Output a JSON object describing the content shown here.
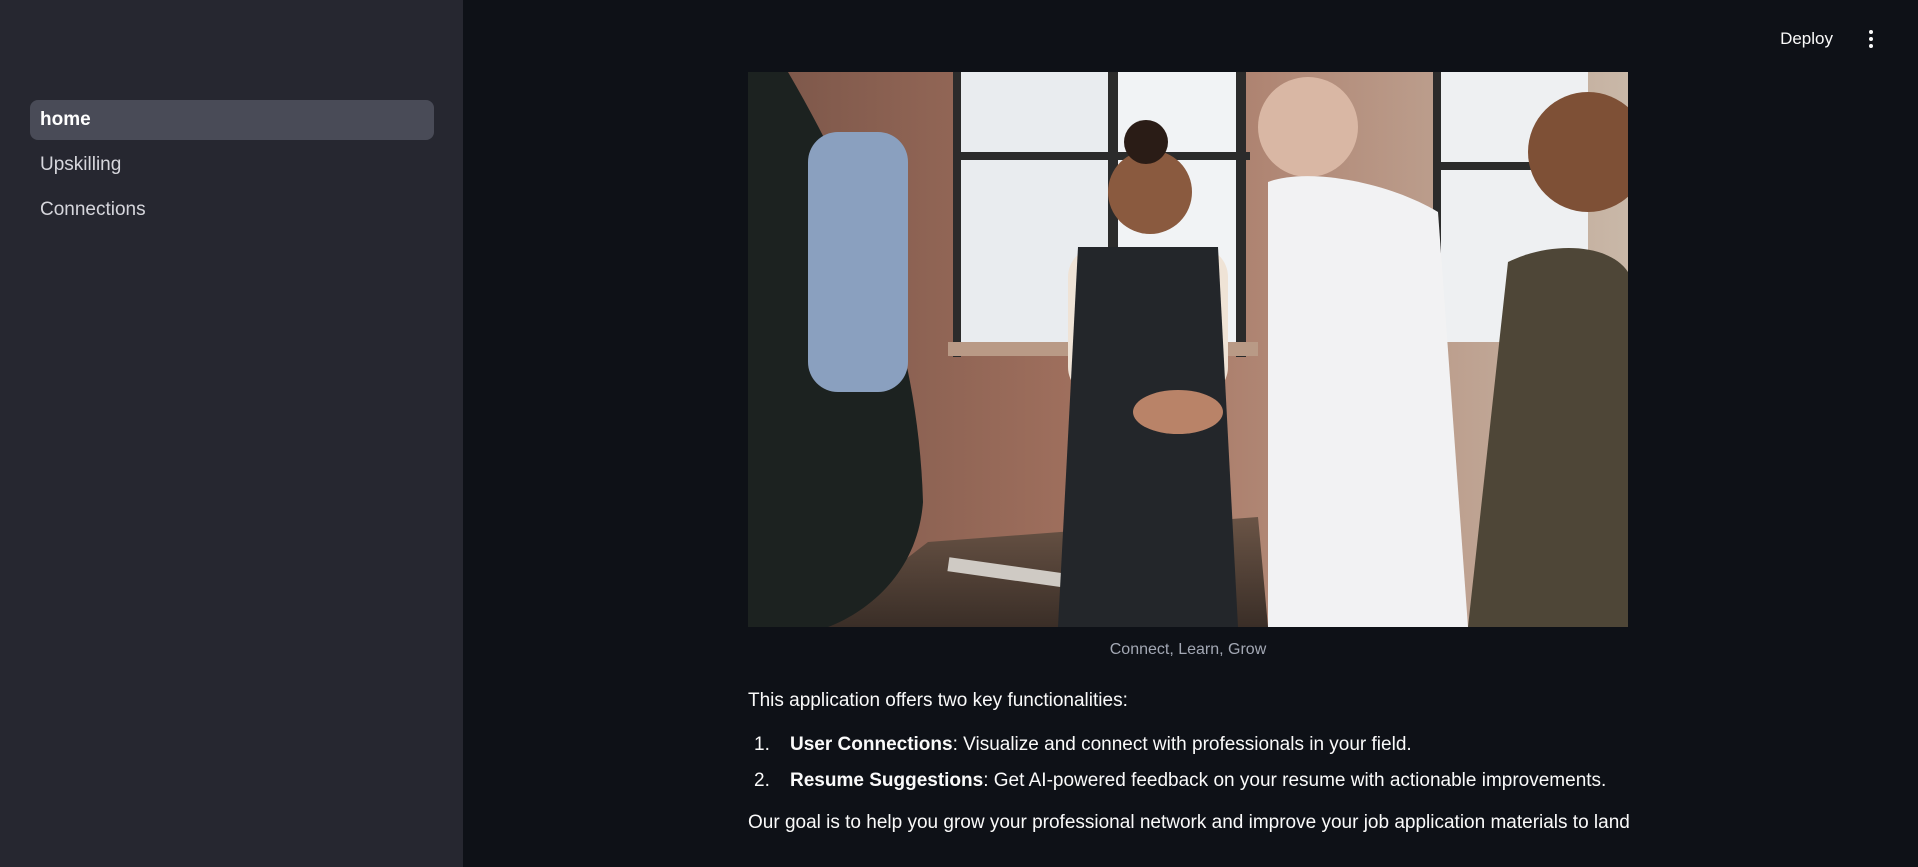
{
  "sidebar": {
    "items": [
      {
        "label": "home",
        "active": true
      },
      {
        "label": "Upskilling",
        "active": false
      },
      {
        "label": "Connections",
        "active": false
      }
    ]
  },
  "header": {
    "deploy_label": "Deploy",
    "menu_icon": "kebab-menu-icon"
  },
  "hero": {
    "caption": "Connect, Learn, Grow"
  },
  "main": {
    "intro": "This application offers two key functionalities:",
    "features": [
      {
        "num": "1.",
        "title": "User Connections",
        "text": ": Visualize and connect with professionals in your field."
      },
      {
        "num": "2.",
        "title": "Resume Suggestions",
        "text": ": Get AI-powered feedback on your resume with actionable improvements."
      }
    ],
    "goal": "Our goal is to help you grow your professional network and improve your job application materials to land"
  },
  "colors": {
    "background": "#0e1117",
    "sidebar": "#262730",
    "active_item": "#494b57",
    "text": "#fafafa"
  }
}
